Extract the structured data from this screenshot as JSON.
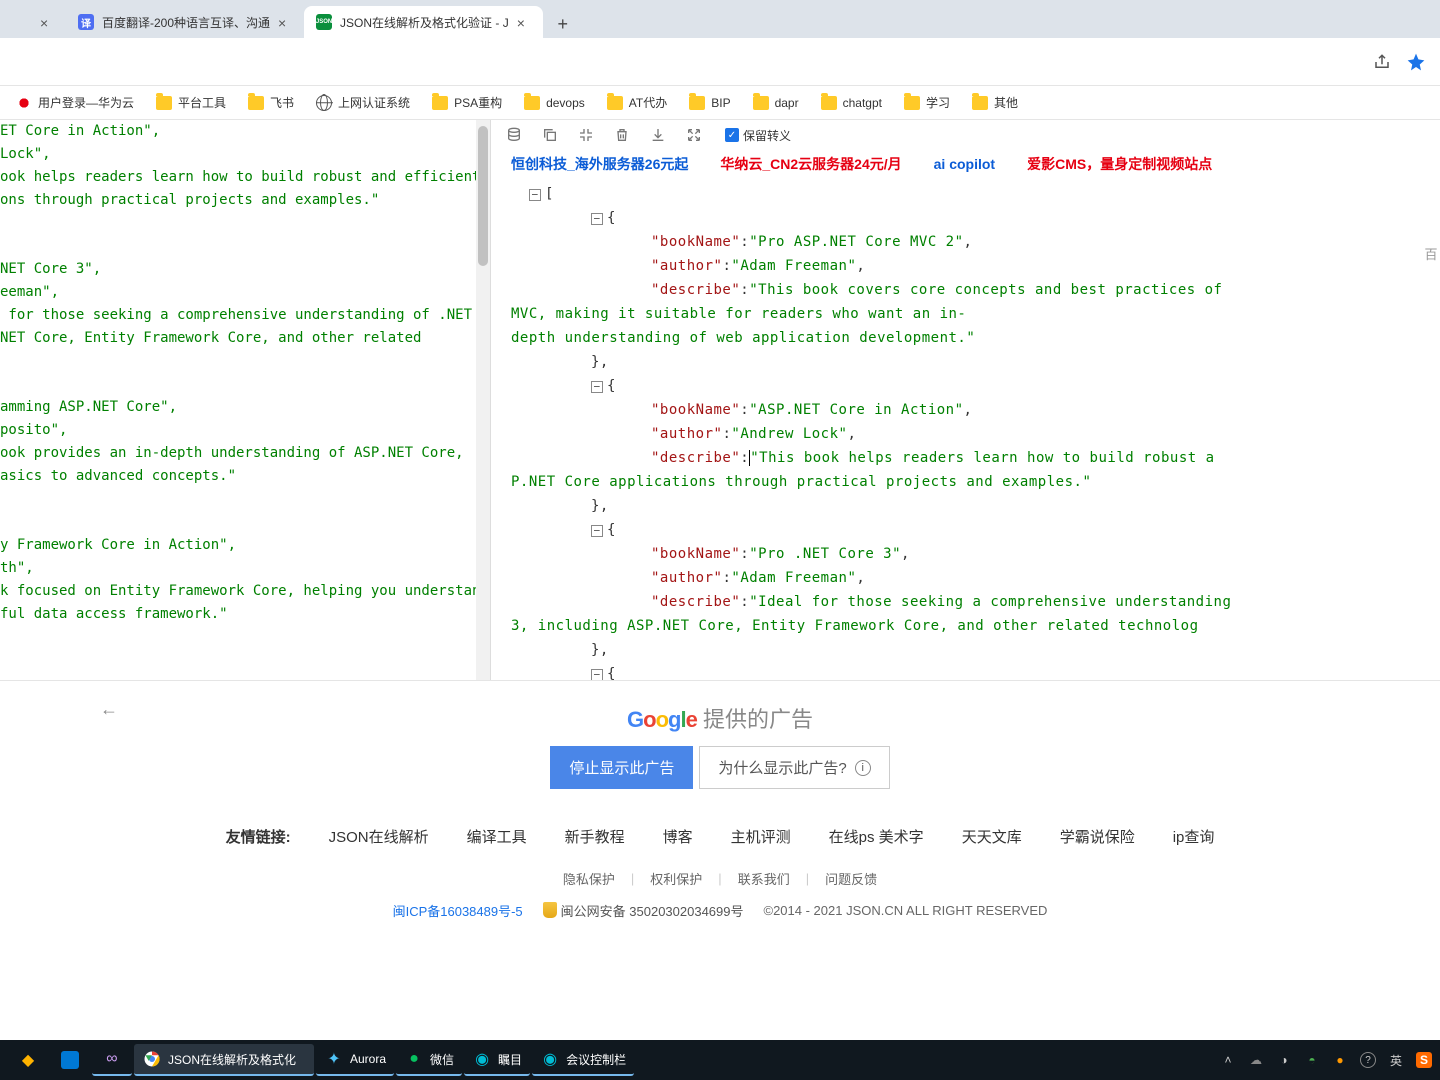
{
  "tabs": [
    {
      "title": "",
      "blank": true
    },
    {
      "title": "百度翻译-200种语言互译、沟通",
      "favicon_bg": "#4e6ef2",
      "favicon_text": "译"
    },
    {
      "title": "JSON在线解析及格式化验证 - J",
      "favicon_bg": "#0a8f3c",
      "favicon_text": "JSON",
      "active": true
    }
  ],
  "bookmarks": [
    {
      "label": "用户登录—华为云",
      "icon": "huawei"
    },
    {
      "label": "平台工具",
      "icon": "folder"
    },
    {
      "label": "飞书",
      "icon": "folder"
    },
    {
      "label": "上网认证系统",
      "icon": "globe"
    },
    {
      "label": "PSA重构",
      "icon": "folder"
    },
    {
      "label": "devops",
      "icon": "folder"
    },
    {
      "label": "AT代办",
      "icon": "folder"
    },
    {
      "label": "BIP",
      "icon": "folder"
    },
    {
      "label": "dapr",
      "icon": "folder"
    },
    {
      "label": "chatgpt",
      "icon": "folder"
    },
    {
      "label": "学习",
      "icon": "folder"
    },
    {
      "label": "其他",
      "icon": "folder"
    }
  ],
  "left_text_lines": [
    "ET Core in Action\",",
    "Lock\",",
    "ook helps readers learn how to build robust and efficient",
    "ons through practical projects and examples.\"",
    "",
    "",
    "NET Core 3\",",
    "eeman\",",
    " for those seeking a comprehensive understanding of .NET",
    "NET Core, Entity Framework Core, and other related",
    "",
    "",
    "amming ASP.NET Core\",",
    "posito\",",
    "ook provides an in-depth understanding of ASP.NET Core,",
    "asics to advanced concepts.\"",
    "",
    "",
    "y Framework Core in Action\",",
    "th\",",
    "k focused on Entity Framework Core, helping you understand",
    "ful data access framework.\""
  ],
  "checkbox_label": "保留转义",
  "promo_links": [
    {
      "text": "恒创科技_海外服务器26元起",
      "color": "#0b5cd6"
    },
    {
      "text": "华纳云_CN2云服务器24元/月",
      "color": "#e60012"
    },
    {
      "text": "ai copilot",
      "color": "#0b5cd6"
    },
    {
      "text": "爱影CMS，量身定制视频站点",
      "color": "#e60012"
    }
  ],
  "json_tree": {
    "book1": {
      "bookName": "Pro  ASP.NET  Core  MVC  2",
      "author": "Adam  Freeman",
      "describe_l1": "This  book  covers  core  concepts  and  best  practices  of",
      "describe_l2": "MVC,  making  it  suitable  for  readers  who  want  an  in-",
      "describe_l3": "depth  understanding  of  web  application  development."
    },
    "book2": {
      "bookName": "ASP.NET  Core  in  Action",
      "author": "Andrew  Lock",
      "describe_l1": "This  book  helps  readers  learn  how  to  build  robust  a",
      "describe_l2": "P.NET  Core  applications  through  practical  projects  and  examples."
    },
    "book3": {
      "bookName": "Pro  .NET  Core  3",
      "author": "Adam  Freeman",
      "describe_l1": "Ideal  for  those  seeking  a  comprehensive  understanding ",
      "describe_l2": "3,  including  ASP.NET  Core,  Entity  Framework  Core,  and  other  related  technolog"
    }
  },
  "right_side_text": "百",
  "ad": {
    "google": "Google",
    "provided": " 提供的广告",
    "stop": "停止显示此广告",
    "why": "为什么显示此广告?"
  },
  "friendly_links": {
    "label": "友情链接:",
    "items": [
      "JSON在线解析",
      "编译工具",
      "新手教程",
      "博客",
      "主机评测",
      "在线ps 美术字",
      "天天文库",
      "学霸说保险",
      "ip查询"
    ]
  },
  "footer2": [
    "隐私保护",
    "权利保护",
    "联系我们",
    "问题反馈"
  ],
  "footer3": {
    "icp": "闽ICP备16038489号-5",
    "beian": "闽公网安备 35020302034699号",
    "copyright": "©2014 - 2021 JSON.CN ALL RIGHT RESERVED"
  },
  "taskbar": {
    "apps": [
      {
        "name": "copilot-preview",
        "color": "#ffb300"
      },
      {
        "name": "widgets",
        "color": "#0078d4"
      },
      {
        "name": "visual-studio",
        "color": "#9b4f96"
      },
      {
        "name": "chrome",
        "label": "JSON在线解析及格式化",
        "active": true
      },
      {
        "name": "aurora",
        "label": "Aurora"
      },
      {
        "name": "wechat",
        "label": "微信"
      },
      {
        "name": "dingding1",
        "label": "瞩目"
      },
      {
        "name": "dingding2",
        "label": "会议控制栏"
      }
    ],
    "tray_ime": "英",
    "tray_sogou": "S"
  }
}
